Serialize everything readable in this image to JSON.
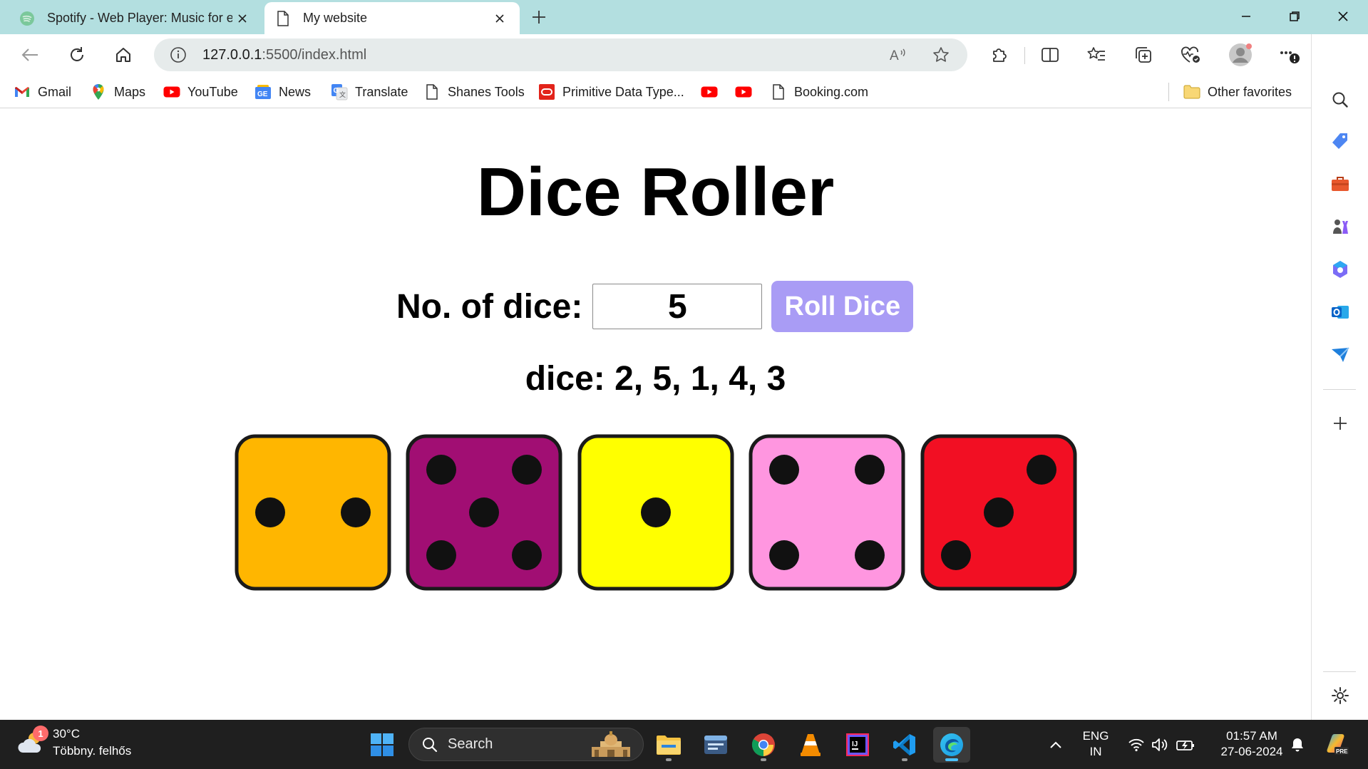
{
  "browser": {
    "tabs": [
      {
        "title": "Spotify - Web Player: Music for e",
        "favicon": "spotify-icon",
        "active": false
      },
      {
        "title": "My website",
        "favicon": "page-icon",
        "active": true
      }
    ],
    "address": {
      "host": "127.0.0.1",
      "rest": ":5500/index.html"
    },
    "favorites": [
      {
        "label": "Gmail",
        "icon": "gmail-icon"
      },
      {
        "label": "Maps",
        "icon": "maps-icon"
      },
      {
        "label": "YouTube",
        "icon": "youtube-icon"
      },
      {
        "label": "News",
        "icon": "news-icon"
      },
      {
        "label": "Translate",
        "icon": "translate-icon"
      },
      {
        "label": "Shanes Tools",
        "icon": "page-icon"
      },
      {
        "label": "Primitive Data Type...",
        "icon": "oracle-icon"
      },
      {
        "label": "Booking.com",
        "icon": "page-icon"
      }
    ],
    "other_favorites": "Other favorites"
  },
  "page": {
    "heading": "Dice Roller",
    "label": "No. of dice:",
    "input_value": "5",
    "button_label": "Roll Dice",
    "result_text": "dice: 2, 5, 1, 4, 3",
    "dice": [
      {
        "value": 2,
        "color": "#ffb600"
      },
      {
        "value": 5,
        "color": "#a10e73"
      },
      {
        "value": 1,
        "color": "#ffff00"
      },
      {
        "value": 4,
        "color": "#ff96e0"
      },
      {
        "value": 3,
        "color": "#f20f23"
      }
    ]
  },
  "colors": {
    "tabstrip": "#b3dfe0",
    "button_bg": "#a99cf5"
  },
  "taskbar": {
    "weather": {
      "temp": "30°C",
      "desc": "Többny. felhős",
      "badge": "1"
    },
    "search_placeholder": "Search",
    "language": {
      "line1": "ENG",
      "line2": "IN"
    },
    "time": "01:57 AM",
    "date": "27-06-2024"
  }
}
